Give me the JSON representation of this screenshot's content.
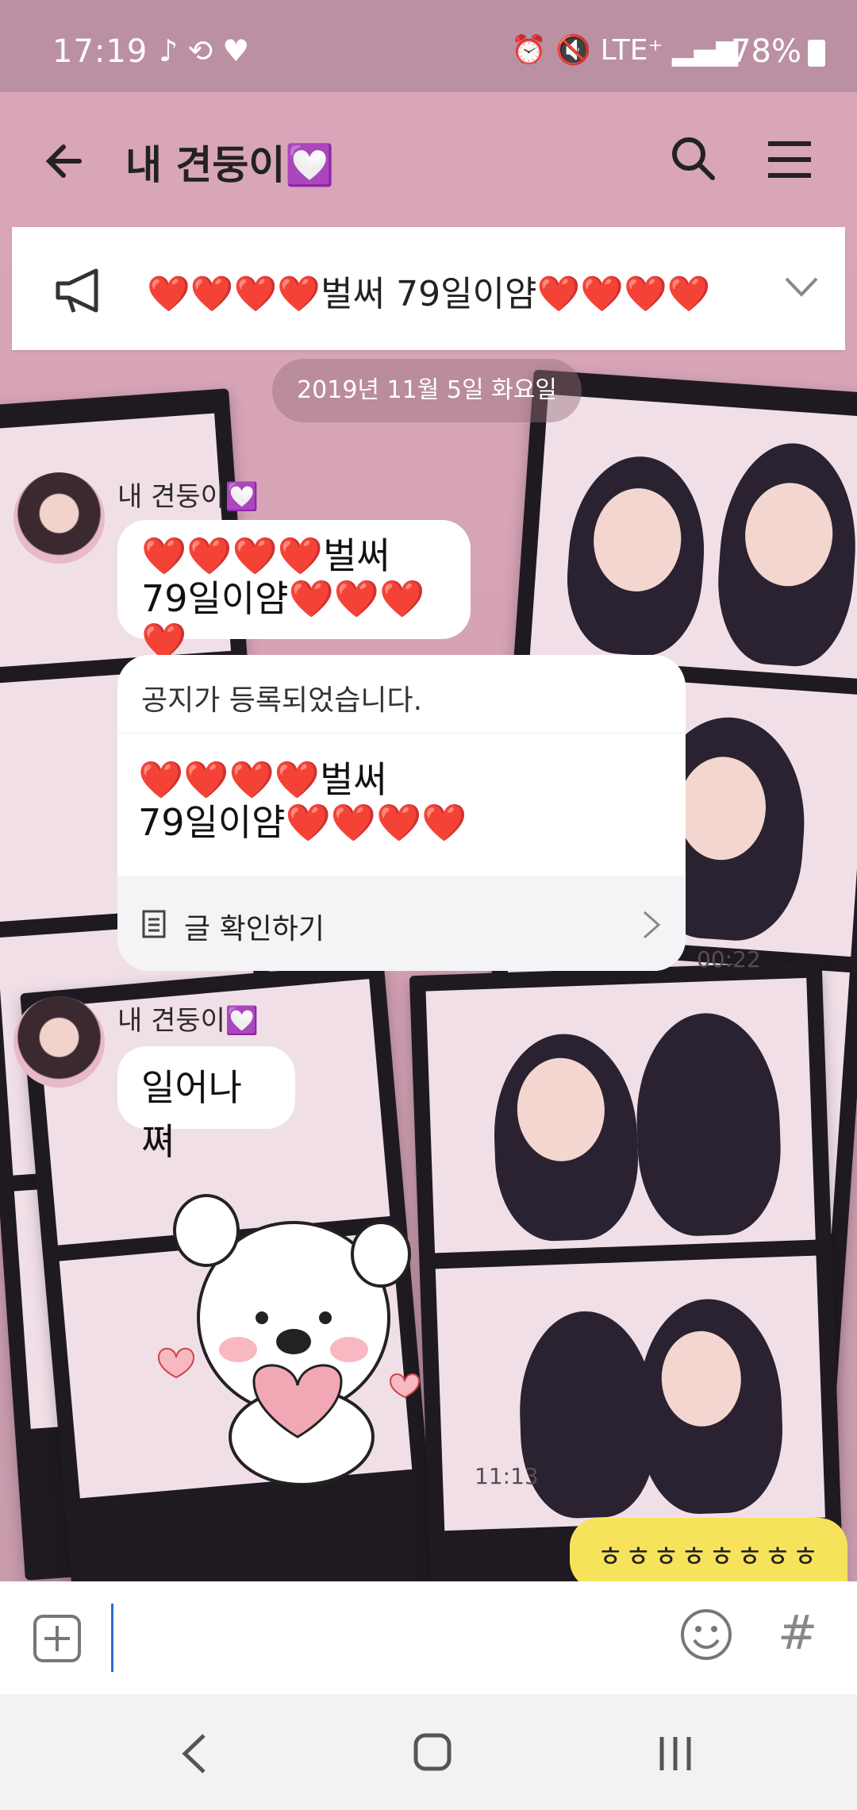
{
  "status": {
    "time": "17:19",
    "left_icons": "♪ ⟲ ♥",
    "network": "LTE⁺",
    "battery": "78%"
  },
  "chat": {
    "title": "내 견둥이💟",
    "notice_banner": "❤️❤️❤️❤️벌써 79일이얌❤️❤️❤️❤️",
    "date": "2019년 11월 5일 화요일"
  },
  "messages": [
    {
      "sender": "내 견둥이💟",
      "line1": "❤️❤️❤️❤️벌써",
      "line2": "79일이얌❤️❤️❤️❤️"
    },
    {
      "sender": "내 견둥이💟",
      "text": "일어나쪄"
    }
  ],
  "notice_card": {
    "header": "공지가 등록되었습니다.",
    "line1": "❤️❤️❤️❤️벌써",
    "line2": "79일이얌❤️❤️❤️❤️",
    "action": "글 확인하기",
    "time": "00:22"
  },
  "sticker_time": "11:13",
  "my_message": "ㅎㅎㅎㅎㅎㅎㅎㅎ",
  "input": {
    "placeholder": ""
  },
  "icons": {
    "back": "arrow-left-icon",
    "search": "search-icon",
    "menu": "menu-icon",
    "megaphone": "megaphone-icon",
    "add": "add-icon",
    "emoji": "emoji-icon",
    "hash": "#"
  },
  "colors": {
    "status_bg": "#b88ea0",
    "my_bubble": "#f7e35b",
    "cursor": "#2b6cd1"
  }
}
